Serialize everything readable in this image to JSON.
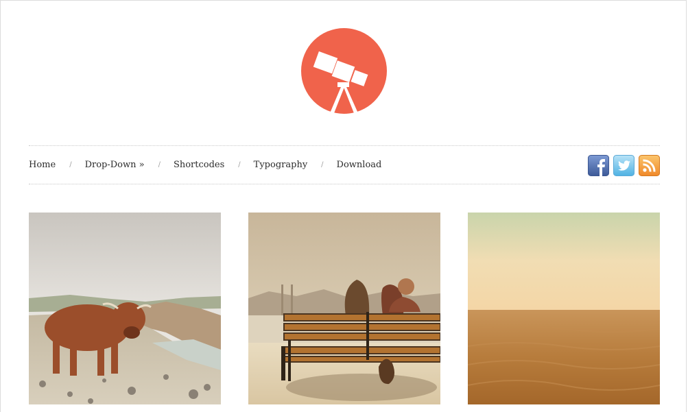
{
  "site": {
    "logo": "telescope-logo",
    "accent_color": "#f0634b"
  },
  "nav": {
    "items": [
      {
        "label": "Home"
      },
      {
        "label": "Drop-Down »"
      },
      {
        "label": "Shortcodes"
      },
      {
        "label": "Typography"
      },
      {
        "label": "Download"
      }
    ],
    "separator": "/"
  },
  "social": {
    "icons": [
      "facebook-icon",
      "twitter-icon",
      "rss-icon"
    ]
  },
  "gallery": {
    "tiles": [
      "highland-cow-on-cliff",
      "couple-on-bench-by-bay",
      "sand-dunes-horizon"
    ]
  }
}
